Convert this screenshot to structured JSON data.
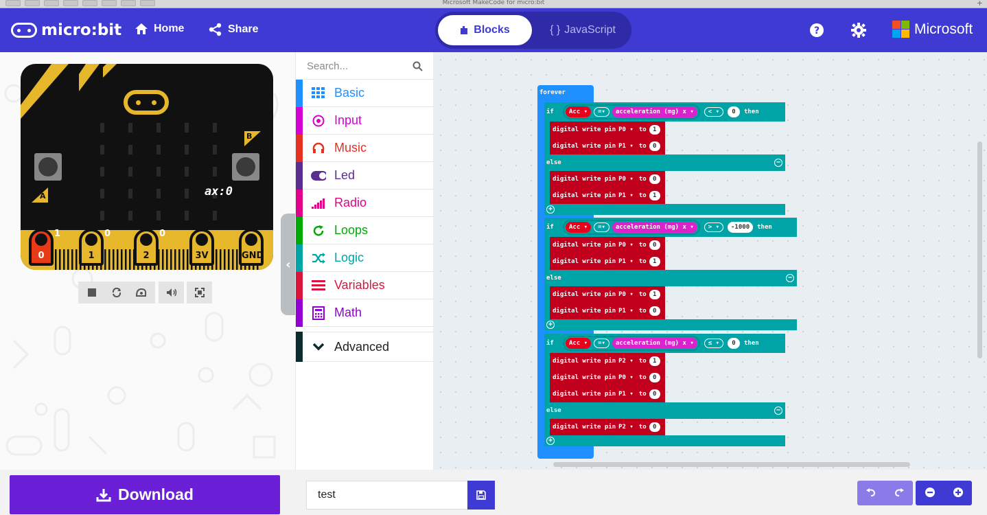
{
  "window_title": "Microsoft MakeCode for micro:bit",
  "brand": {
    "name": "micro:bit"
  },
  "nav": {
    "home": "Home",
    "share": "Share"
  },
  "editor_tabs": {
    "blocks": "Blocks",
    "javascript": "JavaScript"
  },
  "microsoft": "Microsoft",
  "colors": {
    "topbar": "#3e3ad3",
    "download": "#6b1fd6",
    "teal": "#00a4a6",
    "pins_red": "#c0001d",
    "accel_pink": "#dc22cc"
  },
  "simulator": {
    "display_text": "ax:0",
    "button_a": "A",
    "button_b": "B",
    "pins": [
      {
        "label": "0",
        "value": "1"
      },
      {
        "label": "1",
        "value": "0"
      },
      {
        "label": "2",
        "value": "0"
      },
      {
        "label": "3V",
        "value": ""
      },
      {
        "label": "GND",
        "value": ""
      }
    ],
    "tools": [
      "stop-icon",
      "restart-icon",
      "slow-mo-icon",
      "mute-icon",
      "fullscreen-icon"
    ]
  },
  "toolbox": {
    "search_placeholder": "Search...",
    "categories": [
      {
        "label": "Basic",
        "color": "#1e90ff",
        "icon": "grid-icon"
      },
      {
        "label": "Input",
        "color": "#d400d4",
        "icon": "target-icon"
      },
      {
        "label": "Music",
        "color": "#e63022",
        "icon": "headphones-icon"
      },
      {
        "label": "Led",
        "color": "#5c2d91",
        "icon": "toggle-icon"
      },
      {
        "label": "Radio",
        "color": "#e3008c",
        "icon": "signal-icon"
      },
      {
        "label": "Loops",
        "color": "#00aa00",
        "icon": "refresh-icon"
      },
      {
        "label": "Logic",
        "color": "#00a4a6",
        "icon": "shuffle-icon"
      },
      {
        "label": "Variables",
        "color": "#dc143c",
        "icon": "lines-icon"
      },
      {
        "label": "Math",
        "color": "#9400d3",
        "icon": "calculator-icon"
      }
    ],
    "advanced": "Advanced"
  },
  "blocks": {
    "forever": "forever",
    "if_kw": "if",
    "else_kw": "else",
    "then_kw": "then",
    "eq": "=",
    "var": "Acc",
    "accel": "acceleration (mg) x",
    "write": "digital write pin",
    "to": "to",
    "if1": {
      "op": "<",
      "value": "0",
      "then": [
        [
          "P0",
          "1"
        ],
        [
          "P1",
          "0"
        ]
      ],
      "else": [
        [
          "P0",
          "0"
        ],
        [
          "P1",
          "1"
        ]
      ]
    },
    "if2": {
      "op": ">",
      "value": "-1000",
      "then": [
        [
          "P0",
          "0"
        ],
        [
          "P1",
          "1"
        ]
      ],
      "else": [
        [
          "P0",
          "1"
        ],
        [
          "P1",
          "0"
        ]
      ]
    },
    "if3": {
      "op": "≤",
      "value": "0",
      "then": [
        [
          "P2",
          "1"
        ],
        [
          "P0",
          "0"
        ],
        [
          "P1",
          "0"
        ]
      ],
      "else": [
        [
          "P2",
          "0"
        ]
      ]
    }
  },
  "bottom": {
    "download": "Download",
    "project_name": "test"
  }
}
